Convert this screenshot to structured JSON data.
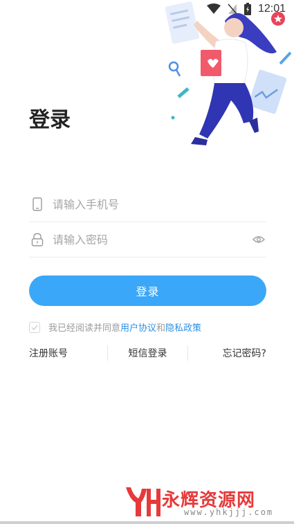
{
  "status_bar": {
    "time": "12:01",
    "icons": [
      "wifi-icon",
      "signal-icon",
      "battery-icon",
      "notification-badge-icon"
    ]
  },
  "page": {
    "title": "登录"
  },
  "form": {
    "phone_placeholder": "请输入手机号",
    "password_placeholder": "请输入密码",
    "login_label": "登录"
  },
  "agreement": {
    "prefix": "我已经阅读并同意",
    "user_agreement": "用户协议",
    "conjunction": "和",
    "privacy_policy": "隐私政策"
  },
  "links": {
    "register": "注册账号",
    "sms_login": "短信登录",
    "forgot_password": "忘记密码?"
  },
  "watermark": {
    "logo_letters": "YH",
    "name": "永辉资源网",
    "url": "www.yhkjjj.com"
  },
  "colors": {
    "primary": "#3aa7f8",
    "link": "#2b8fe8",
    "watermark": "#e63a3a"
  }
}
